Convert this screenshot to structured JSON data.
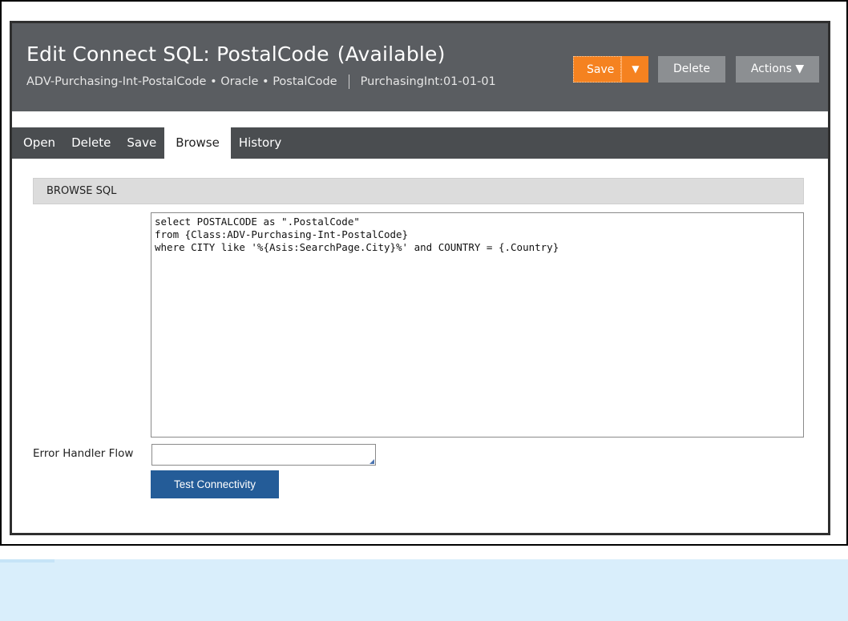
{
  "header": {
    "title": "Edit Connect SQL: PostalCode",
    "status": "(Available)",
    "breadcrumb": "ADV-Purchasing-Int-PostalCode • Oracle • PostalCode",
    "ruleset": "PurchasingInt:01-01-01",
    "save_label": "Save",
    "save_dropdown_icon": "▼",
    "delete_label": "Delete",
    "actions_label": "Actions ▼"
  },
  "tabs": [
    {
      "label": "Open"
    },
    {
      "label": "Delete"
    },
    {
      "label": "Save"
    },
    {
      "label": "Browse"
    },
    {
      "label": "History"
    }
  ],
  "section": {
    "title": "BROWSE SQL"
  },
  "sql": {
    "text": "select POSTALCODE as \".PostalCode\"\nfrom {Class:ADV-Purchasing-Int-PostalCode}\nwhere CITY like '%{Asis:SearchPage.City}%' and COUNTRY = {.Country}"
  },
  "form": {
    "error_handler_label": "Error Handler Flow",
    "error_handler_value": "",
    "test_button_label": "Test Connectivity"
  },
  "colors": {
    "header_bg": "#5a5d61",
    "save_orange": "#f58220",
    "test_button_blue": "#245c98"
  }
}
